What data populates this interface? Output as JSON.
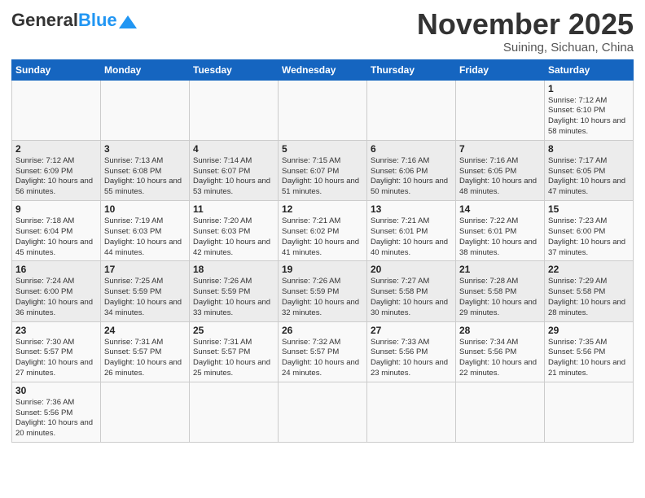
{
  "header": {
    "logo_general": "General",
    "logo_blue": "Blue",
    "month_title": "November 2025",
    "location": "Suining, Sichuan, China"
  },
  "weekdays": [
    "Sunday",
    "Monday",
    "Tuesday",
    "Wednesday",
    "Thursday",
    "Friday",
    "Saturday"
  ],
  "weeks": [
    [
      {
        "day": "",
        "info": ""
      },
      {
        "day": "",
        "info": ""
      },
      {
        "day": "",
        "info": ""
      },
      {
        "day": "",
        "info": ""
      },
      {
        "day": "",
        "info": ""
      },
      {
        "day": "",
        "info": ""
      },
      {
        "day": "1",
        "info": "Sunrise: 7:12 AM\nSunset: 6:10 PM\nDaylight: 10 hours\nand 58 minutes."
      }
    ],
    [
      {
        "day": "2",
        "info": "Sunrise: 7:12 AM\nSunset: 6:09 PM\nDaylight: 10 hours\nand 56 minutes."
      },
      {
        "day": "3",
        "info": "Sunrise: 7:13 AM\nSunset: 6:08 PM\nDaylight: 10 hours\nand 55 minutes."
      },
      {
        "day": "4",
        "info": "Sunrise: 7:14 AM\nSunset: 6:07 PM\nDaylight: 10 hours\nand 53 minutes."
      },
      {
        "day": "5",
        "info": "Sunrise: 7:15 AM\nSunset: 6:07 PM\nDaylight: 10 hours\nand 51 minutes."
      },
      {
        "day": "6",
        "info": "Sunrise: 7:16 AM\nSunset: 6:06 PM\nDaylight: 10 hours\nand 50 minutes."
      },
      {
        "day": "7",
        "info": "Sunrise: 7:16 AM\nSunset: 6:05 PM\nDaylight: 10 hours\nand 48 minutes."
      },
      {
        "day": "8",
        "info": "Sunrise: 7:17 AM\nSunset: 6:05 PM\nDaylight: 10 hours\nand 47 minutes."
      }
    ],
    [
      {
        "day": "9",
        "info": "Sunrise: 7:18 AM\nSunset: 6:04 PM\nDaylight: 10 hours\nand 45 minutes."
      },
      {
        "day": "10",
        "info": "Sunrise: 7:19 AM\nSunset: 6:03 PM\nDaylight: 10 hours\nand 44 minutes."
      },
      {
        "day": "11",
        "info": "Sunrise: 7:20 AM\nSunset: 6:03 PM\nDaylight: 10 hours\nand 42 minutes."
      },
      {
        "day": "12",
        "info": "Sunrise: 7:21 AM\nSunset: 6:02 PM\nDaylight: 10 hours\nand 41 minutes."
      },
      {
        "day": "13",
        "info": "Sunrise: 7:21 AM\nSunset: 6:01 PM\nDaylight: 10 hours\nand 40 minutes."
      },
      {
        "day": "14",
        "info": "Sunrise: 7:22 AM\nSunset: 6:01 PM\nDaylight: 10 hours\nand 38 minutes."
      },
      {
        "day": "15",
        "info": "Sunrise: 7:23 AM\nSunset: 6:00 PM\nDaylight: 10 hours\nand 37 minutes."
      }
    ],
    [
      {
        "day": "16",
        "info": "Sunrise: 7:24 AM\nSunset: 6:00 PM\nDaylight: 10 hours\nand 36 minutes."
      },
      {
        "day": "17",
        "info": "Sunrise: 7:25 AM\nSunset: 5:59 PM\nDaylight: 10 hours\nand 34 minutes."
      },
      {
        "day": "18",
        "info": "Sunrise: 7:26 AM\nSunset: 5:59 PM\nDaylight: 10 hours\nand 33 minutes."
      },
      {
        "day": "19",
        "info": "Sunrise: 7:26 AM\nSunset: 5:59 PM\nDaylight: 10 hours\nand 32 minutes."
      },
      {
        "day": "20",
        "info": "Sunrise: 7:27 AM\nSunset: 5:58 PM\nDaylight: 10 hours\nand 30 minutes."
      },
      {
        "day": "21",
        "info": "Sunrise: 7:28 AM\nSunset: 5:58 PM\nDaylight: 10 hours\nand 29 minutes."
      },
      {
        "day": "22",
        "info": "Sunrise: 7:29 AM\nSunset: 5:58 PM\nDaylight: 10 hours\nand 28 minutes."
      }
    ],
    [
      {
        "day": "23",
        "info": "Sunrise: 7:30 AM\nSunset: 5:57 PM\nDaylight: 10 hours\nand 27 minutes."
      },
      {
        "day": "24",
        "info": "Sunrise: 7:31 AM\nSunset: 5:57 PM\nDaylight: 10 hours\nand 26 minutes."
      },
      {
        "day": "25",
        "info": "Sunrise: 7:31 AM\nSunset: 5:57 PM\nDaylight: 10 hours\nand 25 minutes."
      },
      {
        "day": "26",
        "info": "Sunrise: 7:32 AM\nSunset: 5:57 PM\nDaylight: 10 hours\nand 24 minutes."
      },
      {
        "day": "27",
        "info": "Sunrise: 7:33 AM\nSunset: 5:56 PM\nDaylight: 10 hours\nand 23 minutes."
      },
      {
        "day": "28",
        "info": "Sunrise: 7:34 AM\nSunset: 5:56 PM\nDaylight: 10 hours\nand 22 minutes."
      },
      {
        "day": "29",
        "info": "Sunrise: 7:35 AM\nSunset: 5:56 PM\nDaylight: 10 hours\nand 21 minutes."
      }
    ],
    [
      {
        "day": "30",
        "info": "Sunrise: 7:36 AM\nSunset: 5:56 PM\nDaylight: 10 hours\nand 20 minutes."
      },
      {
        "day": "",
        "info": ""
      },
      {
        "day": "",
        "info": ""
      },
      {
        "day": "",
        "info": ""
      },
      {
        "day": "",
        "info": ""
      },
      {
        "day": "",
        "info": ""
      },
      {
        "day": "",
        "info": ""
      }
    ]
  ]
}
